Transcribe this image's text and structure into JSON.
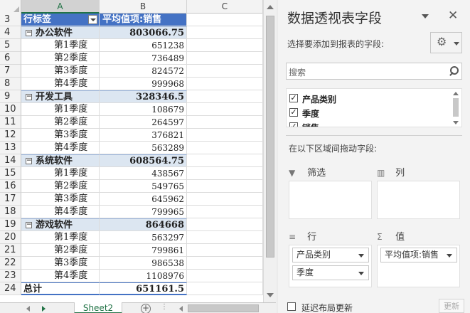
{
  "sheet": {
    "columns": [
      "A",
      "B",
      "C"
    ],
    "header": {
      "row": "3",
      "row_labels": "行标签",
      "value_header": "平均值项:销售"
    },
    "rows": [
      {
        "n": "4",
        "kind": "grp",
        "label": "办公软件",
        "value": "803066.75"
      },
      {
        "n": "5",
        "kind": "item",
        "label": "第1季度",
        "value": "651238"
      },
      {
        "n": "6",
        "kind": "item",
        "label": "第2季度",
        "value": "736489"
      },
      {
        "n": "7",
        "kind": "item",
        "label": "第3季度",
        "value": "824572"
      },
      {
        "n": "8",
        "kind": "item",
        "label": "第4季度",
        "value": "999968"
      },
      {
        "n": "9",
        "kind": "grp",
        "label": "开发工具",
        "value": "328346.5"
      },
      {
        "n": "10",
        "kind": "item",
        "label": "第1季度",
        "value": "108679"
      },
      {
        "n": "11",
        "kind": "item",
        "label": "第2季度",
        "value": "264597"
      },
      {
        "n": "12",
        "kind": "item",
        "label": "第3季度",
        "value": "376821"
      },
      {
        "n": "13",
        "kind": "item",
        "label": "第4季度",
        "value": "563289"
      },
      {
        "n": "14",
        "kind": "grp",
        "label": "系统软件",
        "value": "608564.75"
      },
      {
        "n": "15",
        "kind": "item",
        "label": "第1季度",
        "value": "438567"
      },
      {
        "n": "16",
        "kind": "item",
        "label": "第2季度",
        "value": "549765"
      },
      {
        "n": "17",
        "kind": "item",
        "label": "第3季度",
        "value": "645962"
      },
      {
        "n": "18",
        "kind": "item",
        "label": "第4季度",
        "value": "799965"
      },
      {
        "n": "19",
        "kind": "grp",
        "label": "游戏软件",
        "value": "864668"
      },
      {
        "n": "20",
        "kind": "item",
        "label": "第1季度",
        "value": "563297"
      },
      {
        "n": "21",
        "kind": "item",
        "label": "第2季度",
        "value": "799861"
      },
      {
        "n": "22",
        "kind": "item",
        "label": "第3季度",
        "value": "986538"
      },
      {
        "n": "23",
        "kind": "item",
        "label": "第4季度",
        "value": "1108976"
      },
      {
        "n": "24",
        "kind": "tot",
        "label": "总计",
        "value": "651161.5"
      }
    ],
    "collapse_glyph": "−",
    "sheet_tab": "Sheet2",
    "add_sheet": "+",
    "tab_dots": "⋮"
  },
  "panel": {
    "title": "数据透视表字段",
    "close": "✕",
    "choose_fields": "选择要添加到报表的字段:",
    "gear": "⚙",
    "search_placeholder": "搜索",
    "fields": [
      {
        "label": "产品类别",
        "checked": "✓"
      },
      {
        "label": "季度",
        "checked": "✓"
      },
      {
        "label": "销售",
        "checked": "✓"
      }
    ],
    "drag_hint": "在以下区域间拖动字段:",
    "areas": {
      "filters": {
        "label": "筛选",
        "icon": "▼"
      },
      "columns": {
        "label": "列",
        "icon": "▥"
      },
      "rows": {
        "label": "行",
        "icon": "≡",
        "pills": [
          "产品类别",
          "季度"
        ]
      },
      "values": {
        "label": "值",
        "icon": "Σ",
        "pills": [
          "平均值项:销售"
        ]
      }
    },
    "defer_label": "延迟布局更新",
    "update_button": "更新"
  },
  "colors": {
    "header_blue": "#4472c4",
    "group_fill": "#dce6f1",
    "excel_green": "#217346"
  }
}
